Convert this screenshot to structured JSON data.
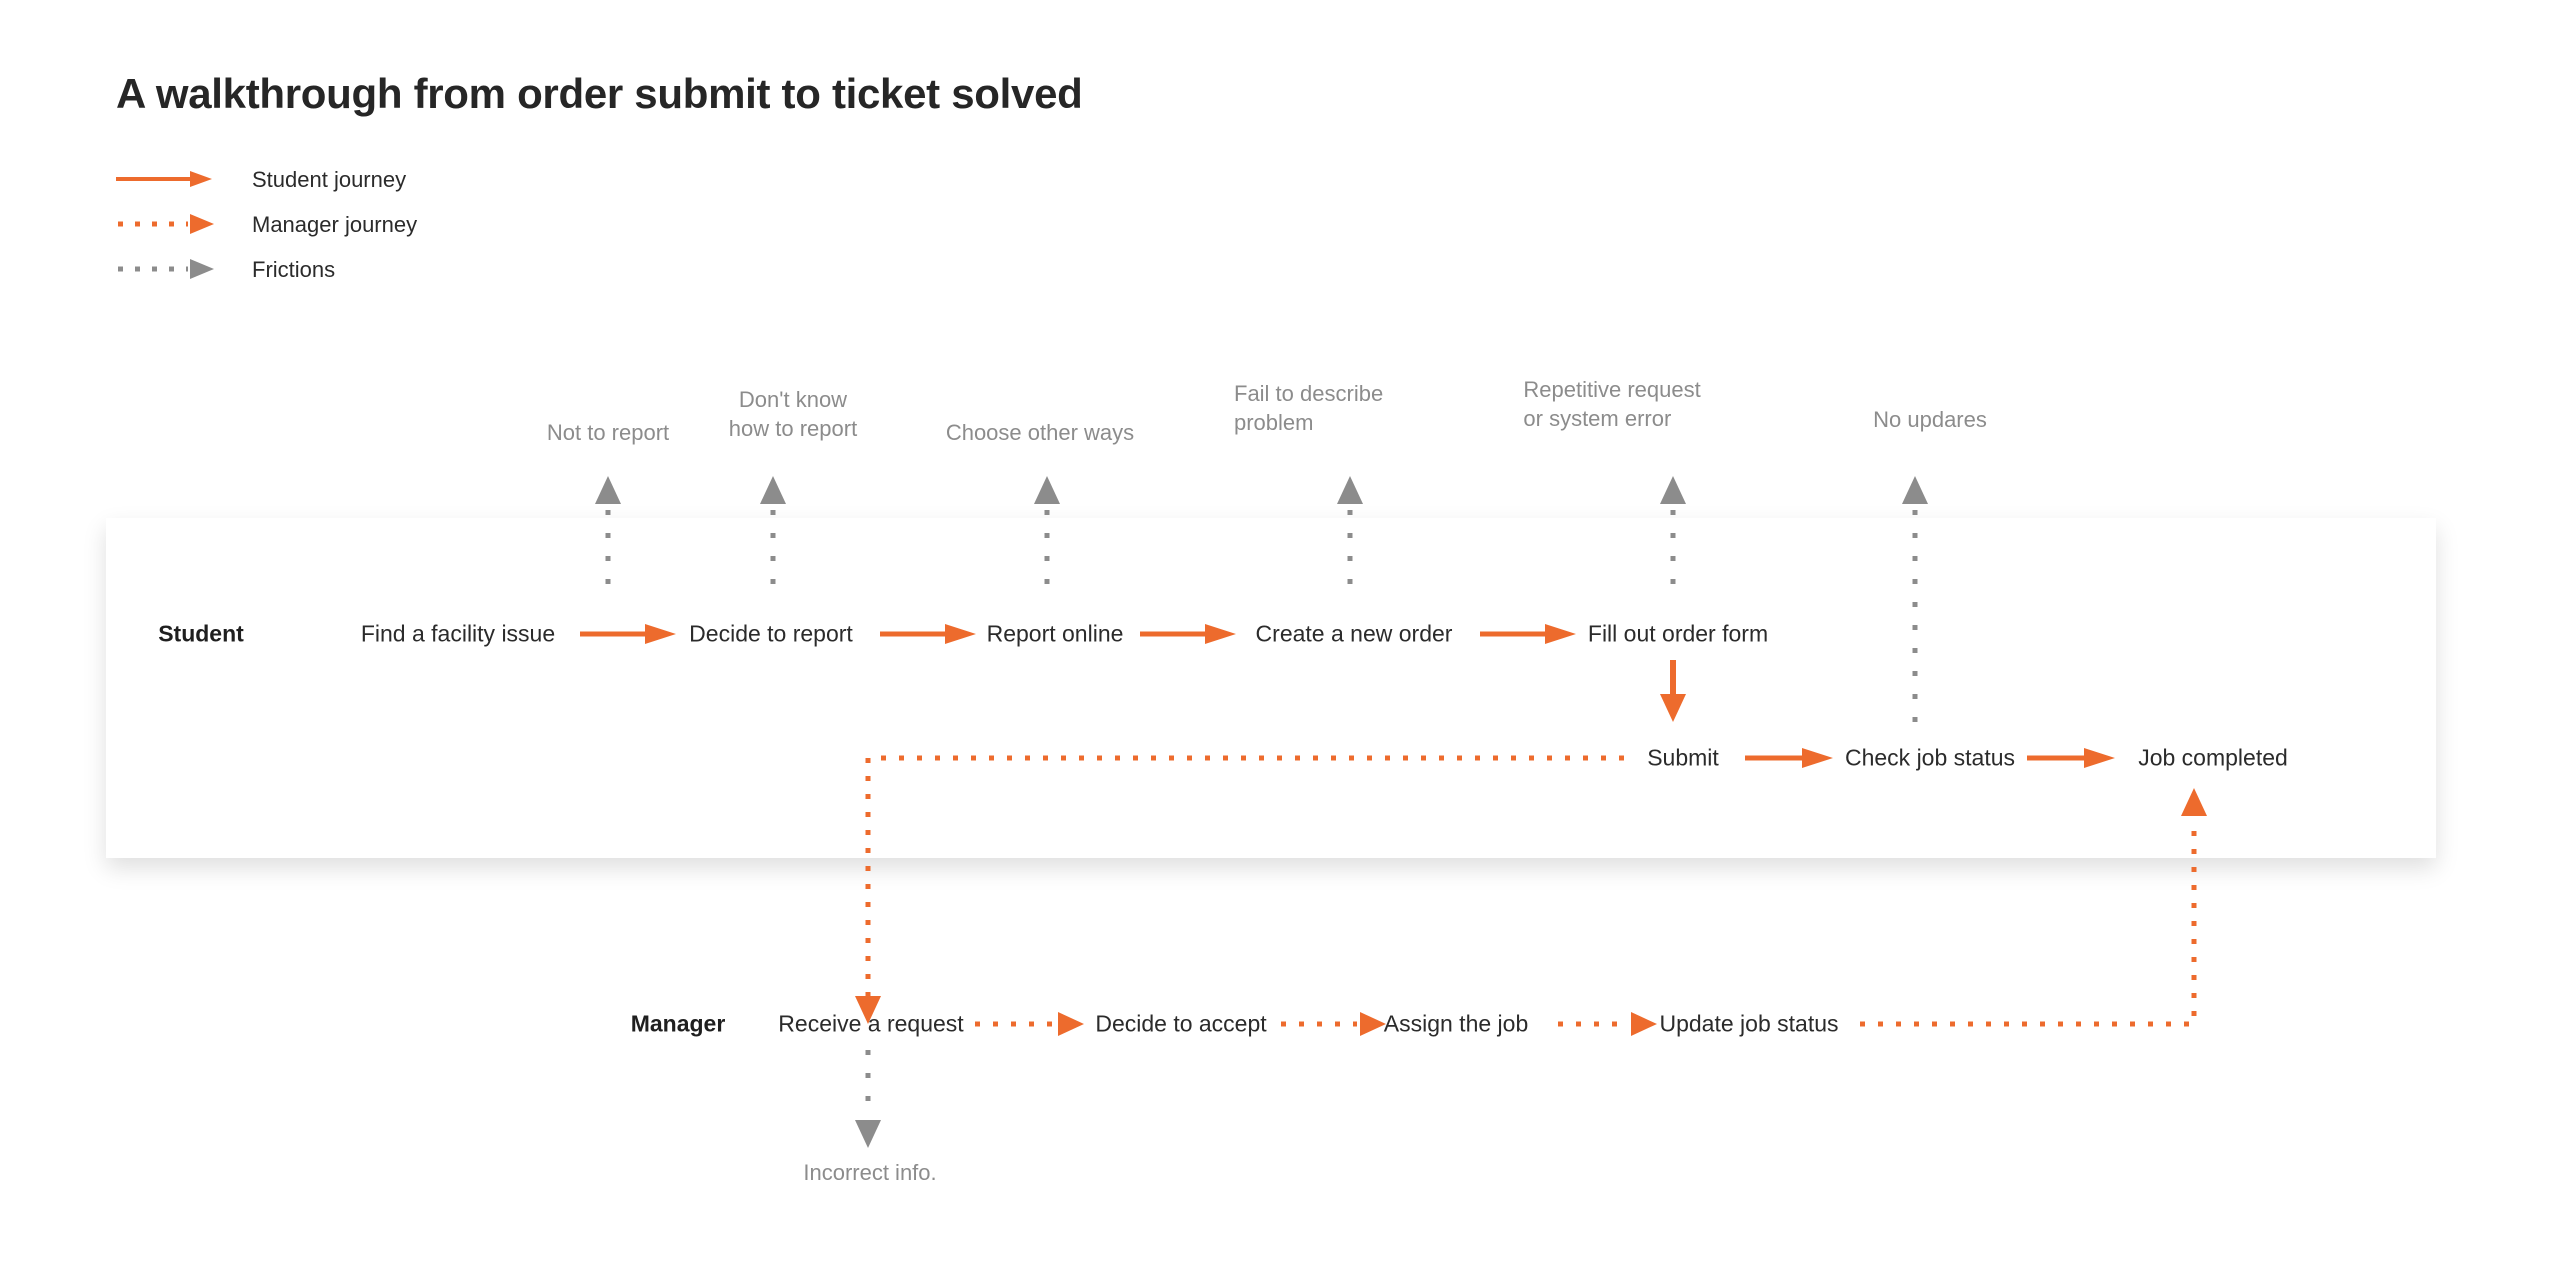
{
  "page": {
    "title": "A walkthrough from order submit to ticket solved",
    "background_color": "#ffffff",
    "accent_color": "#ED6B2D",
    "friction_color": "#808080",
    "text_color": "#2b2b2b"
  },
  "legend": {
    "items": [
      {
        "label": "Student journey",
        "style": "solid-arrow",
        "color": "#ED6B2D"
      },
      {
        "label": "Manager journey",
        "style": "dotted-arrow",
        "color": "#ED6B2D"
      },
      {
        "label": "Frictions",
        "style": "dotted-arrow",
        "color": "#808080"
      }
    ]
  },
  "lanes": {
    "student_label": "Student",
    "manager_label": "Manager"
  },
  "student_row_1": {
    "nodes": [
      "Find a facility issue",
      "Decide to report",
      "Report online",
      "Create a new order",
      "Fill out order form"
    ]
  },
  "student_row_2": {
    "nodes": [
      "Submit",
      "Check job status",
      "Job completed"
    ]
  },
  "manager_row": {
    "nodes": [
      "Receive a request",
      "Decide to accept",
      "Assign the job",
      "Update job status"
    ]
  },
  "frictions": {
    "top": [
      "Not to report",
      "Don't know\nhow to report",
      "Choose other ways",
      "Fail  to describe\nproblem",
      "Repetitive request\nor system error",
      "No updares"
    ],
    "bottom": [
      "Incorrect info."
    ]
  },
  "chart_data": {
    "type": "diagram",
    "title": "A walkthrough from order submit to ticket solved",
    "lanes": [
      "Student",
      "Manager"
    ],
    "legend": [
      "Student journey",
      "Manager journey",
      "Frictions"
    ],
    "student_journey": [
      "Find a facility issue",
      "Decide to report",
      "Report online",
      "Create a new order",
      "Fill out order form",
      "Submit",
      "Check job status",
      "Job completed"
    ],
    "manager_journey": [
      "Receive a request",
      "Decide to accept",
      "Assign the job",
      "Update job status"
    ],
    "friction_points": [
      {
        "label": "Not to report",
        "attached_to": "Find a facility issue"
      },
      {
        "label": "Don't know how to report",
        "attached_to": "Decide to report"
      },
      {
        "label": "Choose other ways",
        "attached_to": "Report online"
      },
      {
        "label": "Fail  to describe problem",
        "attached_to": "Create a new order"
      },
      {
        "label": "Repetitive request or system error",
        "attached_to": "Fill out order form"
      },
      {
        "label": "No updares",
        "attached_to": "Check job status"
      },
      {
        "label": "Incorrect info.",
        "attached_to": "Receive a request"
      }
    ],
    "cross_lane_links": [
      {
        "from": "Submit",
        "to": "Receive a request",
        "style": "manager-dotted"
      },
      {
        "from": "Update job status",
        "to": "Job completed",
        "style": "manager-dotted"
      }
    ]
  }
}
